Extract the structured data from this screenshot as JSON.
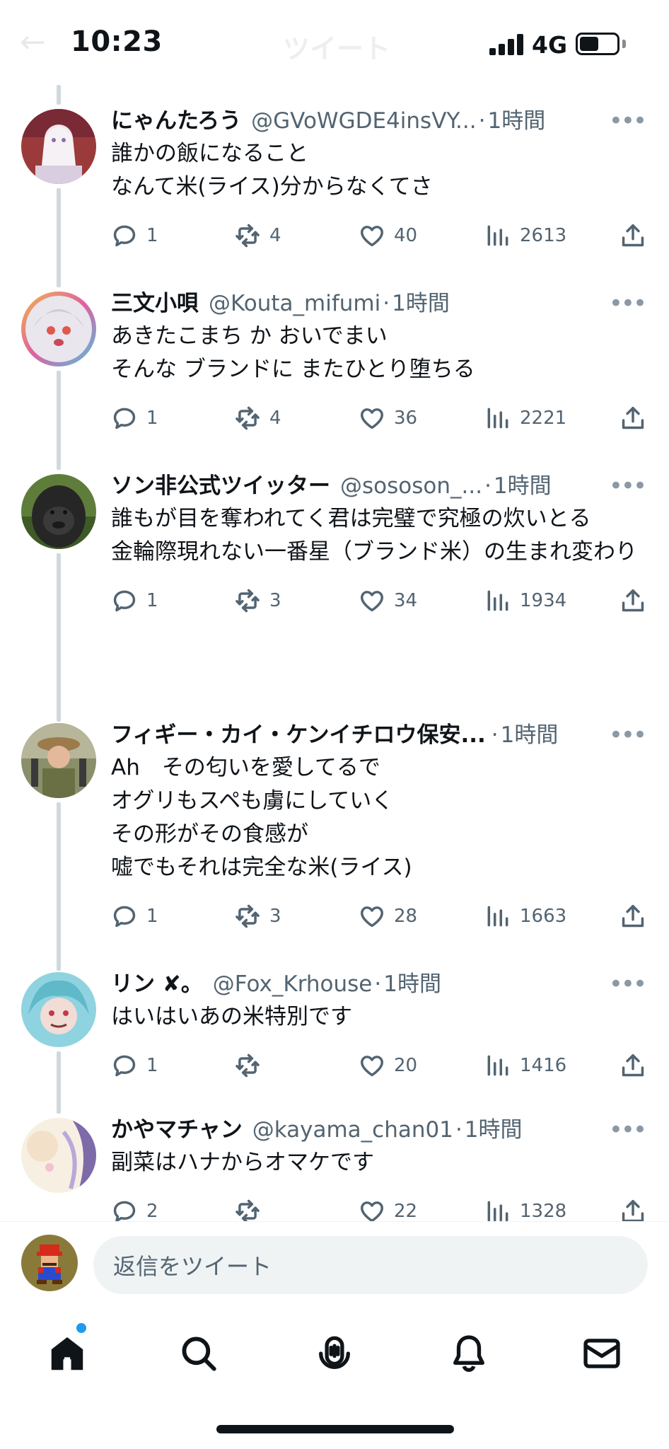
{
  "status_bar": {
    "time": "10:23",
    "network": "4G"
  },
  "header": {
    "back_icon": "back-arrow-icon",
    "title": "ツイート"
  },
  "tweets": [
    {
      "name": "にゃんたろう",
      "handle": "@GVoWGDE4insVY...",
      "time": "1時間",
      "text": "誰かの飯になること\nなんて米(ライス)分からなくてさ",
      "replies": "1",
      "retweets": "4",
      "likes": "40",
      "views": "2613"
    },
    {
      "name": "三文小唄",
      "handle": "@Kouta_mifumi",
      "time": "1時間",
      "text": "あきたこまち か おいでまい\nそんな ブランドに またひとり堕ちる",
      "replies": "1",
      "retweets": "4",
      "likes": "36",
      "views": "2221"
    },
    {
      "name": "ソン非公式ツイッター",
      "handle": "@sososon_...",
      "time": "1時間",
      "text": "誰もが目を奪われてく君は完璧で究極の炊いとる\n金輪際現れない一番星（ブランド米）の生まれ変わり",
      "replies": "1",
      "retweets": "3",
      "likes": "34",
      "views": "1934"
    },
    {
      "name": "フィギー・カイ・ケンイチロウ保安...",
      "handle": "",
      "time": "1時間",
      "text": "Ah　その匂いを愛してるで\nオグリもスペも虜にしていく\nその形がその食感が\n嘘でもそれは完全な米(ライス)",
      "replies": "1",
      "retweets": "3",
      "likes": "28",
      "views": "1663"
    },
    {
      "name": "リン ✘。",
      "handle": "@Fox_Krhouse",
      "time": "1時間",
      "text": "はいはいあの米特別です",
      "replies": "1",
      "retweets": "",
      "likes": "20",
      "views": "1416"
    },
    {
      "name": "かやマチャン",
      "handle": "@kayama_chan01",
      "time": "1時間",
      "text": "副菜はハナからオマケです",
      "replies": "2",
      "retweets": "",
      "likes": "22",
      "views": "1328"
    }
  ],
  "reply_bar": {
    "placeholder": "返信をツイート"
  },
  "tab_bar": {
    "items": [
      "home-icon",
      "search-icon",
      "spaces-icon",
      "notifications-icon",
      "messages-icon"
    ],
    "notification_dot_color": "#1d9bf0"
  },
  "colors": {
    "text": "#0f1419",
    "secondary": "#536471",
    "thread_line": "#cfd9de",
    "accent": "#1d9bf0"
  }
}
